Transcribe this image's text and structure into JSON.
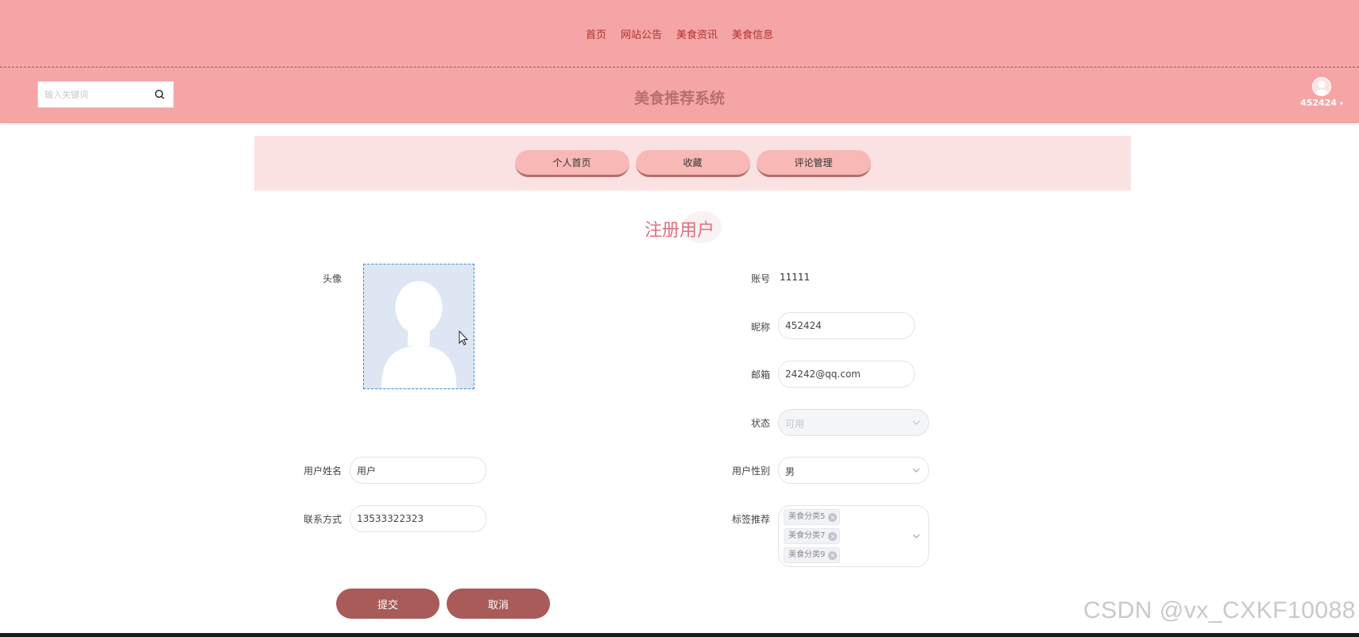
{
  "nav": {
    "items": [
      "首页",
      "网站公告",
      "美食资讯",
      "美食信息"
    ]
  },
  "header": {
    "search_placeholder": "输入关键词",
    "site_title": "美食推荐系统",
    "username": "452424"
  },
  "tabs": [
    "个人首页",
    "收藏",
    "评论管理"
  ],
  "form": {
    "title": "注册用户",
    "avatar_label": "头像",
    "account_label": "账号",
    "account_value": "11111",
    "nickname_label": "昵称",
    "nickname_value": "452424",
    "email_label": "邮箱",
    "email_value": "24242@qq.com",
    "status_label": "状态",
    "status_value": "可用",
    "realname_label": "用户姓名",
    "realname_value": "用户",
    "gender_label": "用户性别",
    "gender_value": "男",
    "phone_label": "联系方式",
    "phone_value": "13533322323",
    "tags_label": "标签推荐",
    "tags": [
      "美食分类5",
      "美食分类7",
      "美食分类9"
    ],
    "submit_label": "提交",
    "cancel_label": "取消"
  },
  "watermark": "CSDN @vx_CXKF10088",
  "colors": {
    "primary": "#f5a5a5",
    "accent_button": "#a85b59",
    "heading": "#e0707f"
  }
}
